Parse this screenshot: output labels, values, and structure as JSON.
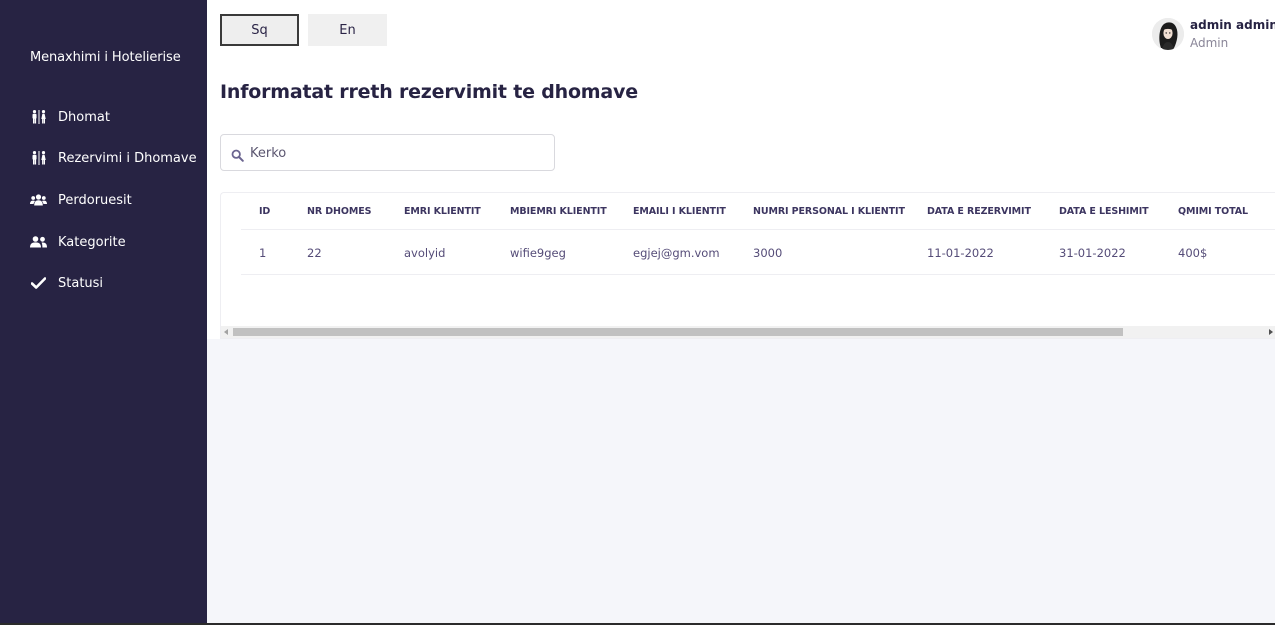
{
  "sidebar": {
    "brand": "Menaxhimi i Hotelierise",
    "items": [
      {
        "label": "Dhomat",
        "icon": "restroom-icon"
      },
      {
        "label": "Rezervimi i Dhomave",
        "icon": "restroom-icon"
      },
      {
        "label": "Perdoruesit",
        "icon": "users-icon"
      },
      {
        "label": "Kategorite",
        "icon": "user-friends-icon"
      },
      {
        "label": "Statusi",
        "icon": "check-icon"
      }
    ]
  },
  "header": {
    "languages": [
      {
        "label": "Sq",
        "selected": true
      },
      {
        "label": "En",
        "selected": false
      }
    ],
    "user": {
      "name": "admin admin",
      "role": "Admin"
    }
  },
  "main": {
    "title": "Informatat rreth rezervimit te dhomave",
    "search": {
      "placeholder": "Kerko",
      "value": ""
    },
    "table": {
      "columns": [
        "ID",
        "NR DHOMES",
        "EMRI KLIENTIT",
        "MBIEMRI KLIENTIT",
        "EMAILI I KLIENTIT",
        "NUMRI PERSONAL I KLIENTIT",
        "DATA E REZERVIMIT",
        "DATA E LESHIMIT",
        "QMIMI TOTAL"
      ],
      "rows": [
        [
          "1",
          "22",
          "avolyid",
          "wifie9geg",
          "egjej@gm.vom",
          "3000",
          "11-01-2022",
          "31-01-2022",
          "400$"
        ]
      ]
    }
  },
  "colors": {
    "sidebar": "#272343",
    "page_background": "#f5f6fa",
    "text": "#272343"
  }
}
